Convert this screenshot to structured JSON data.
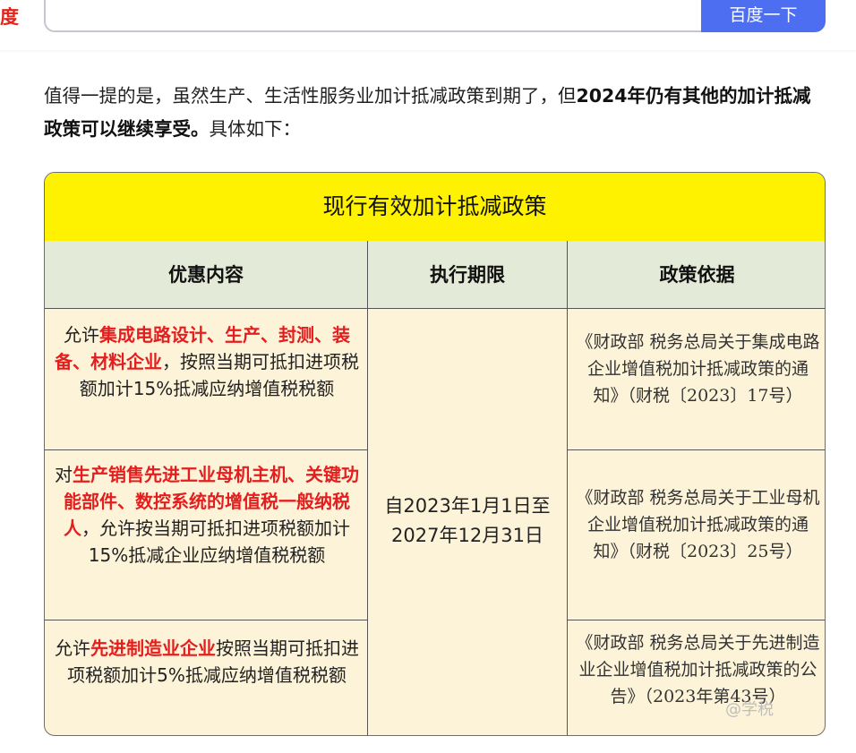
{
  "header": {
    "logo_fragment": "度",
    "search_value": "",
    "search_button": "百度一下"
  },
  "article": {
    "text_plain_1": "值得一提的是，虽然生产、生活性服务业加计抵减政策到期了，但",
    "text_bold": "2024年仍有其他的加计抵减政策可以继续享受。",
    "text_plain_2": "具体如下："
  },
  "table": {
    "title": "现行有效加计抵减政策",
    "headers": [
      "优惠内容",
      "执行期限",
      "政策依据"
    ],
    "period": "自2023年1月1日至2027年12月31日",
    "rows": [
      {
        "content_pre": "允许",
        "content_red": "集成电路设计、生产、封测、装备、材料企业",
        "content_post": "，按照当期可抵扣进项税额加计15%抵减应纳增值税税额",
        "basis": "《财政部 税务总局关于集成电路企业增值税加计抵减政策的通知》（财税〔2023〕17号）"
      },
      {
        "content_pre": "对",
        "content_red": "生产销售先进工业母机主机、关键功能部件、数控系统的增值税一般纳税人",
        "content_post": "，允许按当期可抵扣进项税额加计15%抵减企业应纳增值税税额",
        "basis": "《财政部 税务总局关于工业母机企业增值税加计抵减政策的通知》（财税〔2023〕25号）"
      },
      {
        "content_pre": "允许",
        "content_red": "先进制造业企业",
        "content_post": "按照当期可抵扣进项税额加计5%抵减应纳增值税税额",
        "basis": "《财政部 税务总局关于先进制造业企业增值税加计抵减政策的公告》（2023年第43号）"
      }
    ],
    "watermark": "@学税"
  }
}
